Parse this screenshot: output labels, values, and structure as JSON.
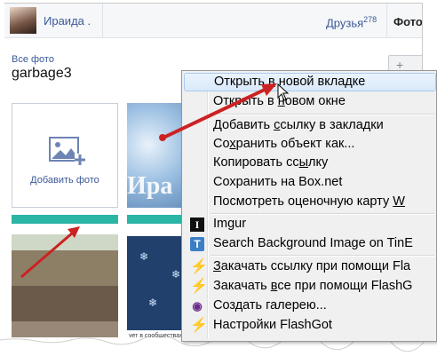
{
  "topbar": {
    "username": "Ираида .",
    "friends_label": "Друзья",
    "friends_count": "278",
    "photos_tab": "Фото"
  },
  "album": {
    "breadcrumb": "Все фото",
    "title": "garbage3",
    "plus_button": "+"
  },
  "tiles": {
    "add_photo_label": "Добавить фото",
    "frost_text": "Ира",
    "thumb2_caption": "ует в сообществах"
  },
  "context_menu": {
    "items": [
      {
        "pre": "Открыть ",
        "u": "в",
        "post": " новой вкладке",
        "highlighted": true
      },
      {
        "pre": "Открыть в ",
        "u": "н",
        "post": "овом окне"
      },
      {
        "pre": "Добавить ",
        "u": "с",
        "post": "сылку в закладки"
      },
      {
        "pre": "Со",
        "u": "х",
        "post": "ранить объект как..."
      },
      {
        "pre": "Копировать сс",
        "u": "ы",
        "post": "лку"
      },
      {
        "pre": "Сохранить на Box.net",
        "u": "",
        "post": ""
      },
      {
        "pre": "Посмотреть оценочную карту ",
        "u": "W",
        "post": ""
      },
      {
        "pre": "Imgur",
        "u": "",
        "post": "",
        "icon": "imgur-icon"
      },
      {
        "pre": "Search Background Image on TinE",
        "u": "",
        "post": "",
        "icon": "tineye-icon"
      },
      {
        "pre": "",
        "u": "З",
        "post": "акачать ссылку при помощи Fla",
        "icon": "flashgot-icon"
      },
      {
        "pre": "Закачать ",
        "u": "в",
        "post": "се при помощи FlashG",
        "icon": "flashgot-all-icon"
      },
      {
        "pre": "Создать галерею...",
        "u": "",
        "post": "",
        "icon": "gallery-eye-icon"
      },
      {
        "pre": "Настройки FlashGot",
        "u": "",
        "post": "",
        "icon": "flashgot-settings-icon"
      }
    ]
  },
  "colors": {
    "link": "#3b5998",
    "annotation_arrow": "#cc2222",
    "menu_highlight": "#d9e9fa"
  }
}
